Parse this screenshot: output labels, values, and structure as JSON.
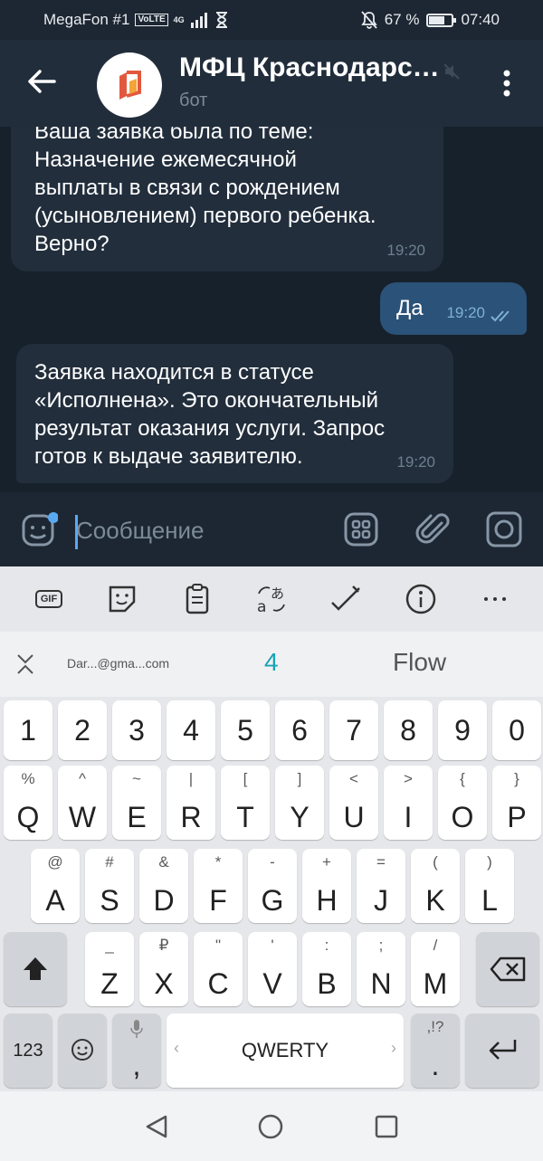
{
  "status_bar": {
    "carrier": "MegaFon #1",
    "volte": "VoLTE",
    "network": "4G",
    "battery_percent": "67 %",
    "battery_level": 0.67,
    "time": "07:40"
  },
  "header": {
    "title": "МФЦ Краснодарск...",
    "subtitle": "бот"
  },
  "messages": [
    {
      "direction": "in",
      "lines": [
        "Ваша заявка была по теме:",
        "Назначение ежемесячной",
        "выплаты в связи с рождением",
        "(усыновлением) первого ребенка.",
        "Верно?"
      ],
      "time": "19:20"
    },
    {
      "direction": "out",
      "lines": [
        "Да"
      ],
      "time": "19:20"
    },
    {
      "direction": "in",
      "lines": [
        "Заявка находится в статусе",
        "«Исполнена». Это окончательный",
        "результат оказания услуги. Запрос",
        "готов к выдаче заявителю."
      ],
      "time": "19:20"
    }
  ],
  "input": {
    "placeholder": "Сообщение"
  },
  "keyboard": {
    "toolbar": [
      "gif-icon",
      "sticker-icon",
      "clipboard-icon",
      "translate-icon",
      "handwriting-icon",
      "info-icon",
      "more-icon"
    ],
    "gif_label": "GIF",
    "suggestions": {
      "email": "Dar...@gma...com",
      "number": "4",
      "word": "Flow"
    },
    "number_row": [
      "1",
      "2",
      "3",
      "4",
      "5",
      "6",
      "7",
      "8",
      "9",
      "0"
    ],
    "row1": [
      {
        "hint": "%",
        "key": "Q"
      },
      {
        "hint": "^",
        "key": "W"
      },
      {
        "hint": "~",
        "key": "E"
      },
      {
        "hint": "|",
        "key": "R"
      },
      {
        "hint": "[",
        "key": "T"
      },
      {
        "hint": "]",
        "key": "Y"
      },
      {
        "hint": "<",
        "key": "U"
      },
      {
        "hint": ">",
        "key": "I"
      },
      {
        "hint": "{",
        "key": "O"
      },
      {
        "hint": "}",
        "key": "P"
      }
    ],
    "row2": [
      {
        "hint": "@",
        "key": "A"
      },
      {
        "hint": "#",
        "key": "S"
      },
      {
        "hint": "&",
        "key": "D"
      },
      {
        "hint": "*",
        "key": "F"
      },
      {
        "hint": "-",
        "key": "G"
      },
      {
        "hint": "+",
        "key": "H"
      },
      {
        "hint": "=",
        "key": "J"
      },
      {
        "hint": "(",
        "key": "K"
      },
      {
        "hint": ")",
        "key": "L"
      }
    ],
    "row3": [
      {
        "hint": "_",
        "key": "Z"
      },
      {
        "hint": "₽",
        "key": "X"
      },
      {
        "hint": "\"",
        "key": "C"
      },
      {
        "hint": "'",
        "key": "V"
      },
      {
        "hint": ":",
        "key": "B"
      },
      {
        "hint": ";",
        "key": "N"
      },
      {
        "hint": "/",
        "key": "M"
      }
    ],
    "symbols_key": "123",
    "comma": ",",
    "space_label": "QWERTY",
    "period_hint": ",!?",
    "period": "."
  },
  "colors": {
    "accent": "#5aa9f0",
    "outgoing_bubble": "#2b5278",
    "incoming_bubble": "#222e3c",
    "suggestion_number": "#1aa3b5"
  }
}
